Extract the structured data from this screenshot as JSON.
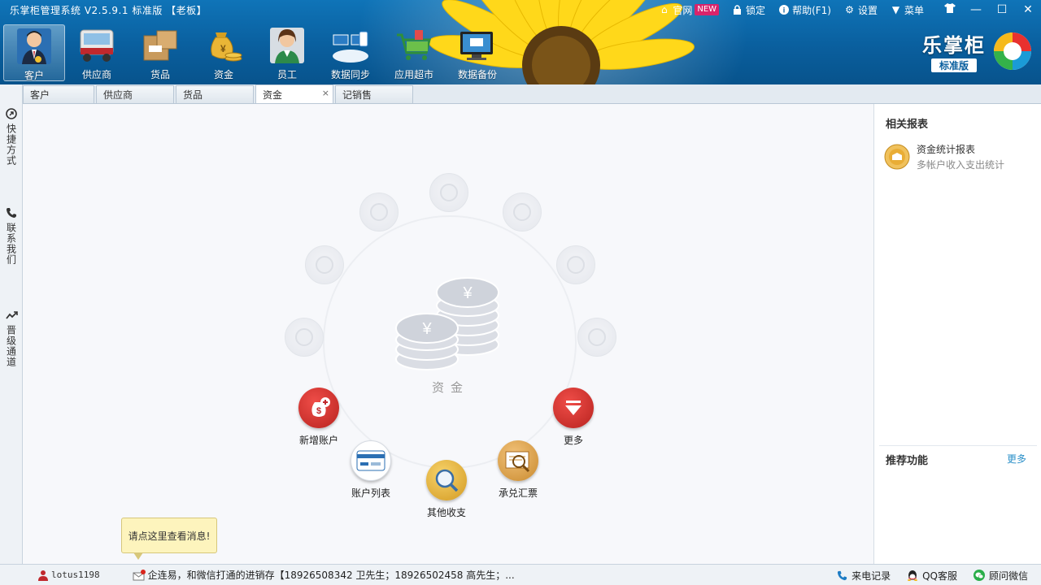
{
  "app": {
    "title": "乐掌柜管理系统 V2.5.9.1 标准版 【老板】",
    "brand_name": "乐掌柜",
    "brand_edition": "标准版"
  },
  "top_links": {
    "website": "官网",
    "new_badge": "NEW",
    "lock": "锁定",
    "help": "帮助(F1)",
    "settings": "设置",
    "menu": "菜单"
  },
  "toolbar": [
    {
      "label": "客户",
      "icon": "customer-icon"
    },
    {
      "label": "供应商",
      "icon": "supplier-truck-icon"
    },
    {
      "label": "货品",
      "icon": "goods-box-icon"
    },
    {
      "label": "资金",
      "icon": "money-bag-icon"
    },
    {
      "label": "员工",
      "icon": "staff-icon"
    },
    {
      "label": "数据同步",
      "icon": "data-sync-icon"
    },
    {
      "label": "应用超市",
      "icon": "app-market-icon"
    },
    {
      "label": "数据备份",
      "icon": "data-backup-icon"
    }
  ],
  "tabs": [
    {
      "label": "客户"
    },
    {
      "label": "供应商"
    },
    {
      "label": "货品"
    },
    {
      "label": "资金"
    },
    {
      "label": "记销售"
    }
  ],
  "tab_close": "×",
  "left_strip": [
    {
      "label": "快捷方式"
    },
    {
      "label": "联系我们"
    },
    {
      "label": "晋级通道"
    }
  ],
  "main": {
    "center_label": "资金",
    "actions": {
      "add_account": "新增账户",
      "more": "更多",
      "account_list": "账户列表",
      "other_income": "其他收支",
      "acceptance_bill": "承兑汇票"
    }
  },
  "right_panel": {
    "related_reports_title": "相关报表",
    "report_title": "资金统计报表",
    "report_desc": "多帐户收入支出统计",
    "recommended_title": "推荐功能",
    "recommended_more": "更多"
  },
  "tooltip": "请点这里查看消息!",
  "statusbar": {
    "user": "lotus1198",
    "message": "企连易，和微信打通的进销存【18926508342 卫先生；18926502458 高先生；...",
    "call_log": "来电记录",
    "qq_service": "QQ客服",
    "wechat_advisor": "顾问微信"
  }
}
